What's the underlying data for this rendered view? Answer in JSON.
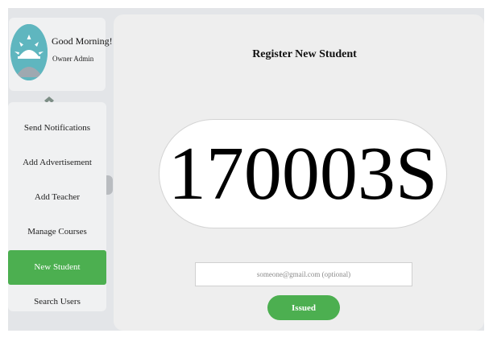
{
  "profile": {
    "greeting": "Good Morning!",
    "role": "Owner Admin",
    "avatar_icon": "sunrise-icon",
    "avatar_color": "#5fb6bf"
  },
  "sidebar": {
    "toggle_icon": "collapse-chevron-icon",
    "items": [
      {
        "label": "Send Notifications",
        "active": false
      },
      {
        "label": "Add Advertisement",
        "active": false
      },
      {
        "label": "Add Teacher",
        "active": false
      },
      {
        "label": "Manage Courses",
        "active": false
      },
      {
        "label": "New Student",
        "active": true
      },
      {
        "label": "Search Users",
        "active": false
      }
    ]
  },
  "main": {
    "title": "Register New Student",
    "student_id": "170003S",
    "email": {
      "value": "",
      "placeholder": "someone@gmail.com (optional)"
    },
    "issue_button_label": "Issued"
  },
  "colors": {
    "accent": "#4caf50",
    "background": "#e3e5e8",
    "panel": "#eeeeee"
  }
}
